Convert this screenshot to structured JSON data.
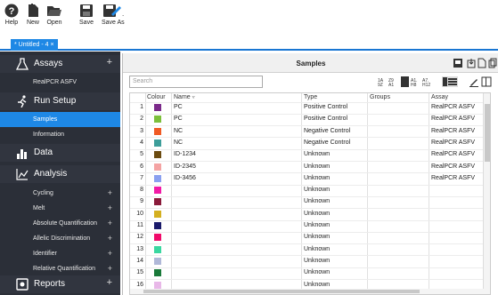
{
  "toolbar": {
    "help": "Help",
    "new": "New",
    "open": "Open",
    "save": "Save",
    "save_as": "Save As"
  },
  "tab": {
    "label": "* Untitled - 4  ×"
  },
  "sidebar": {
    "assays": "Assays",
    "realpcr": "RealPCR ASFV",
    "run_setup": "Run Setup",
    "samples": "Samples",
    "information": "Information",
    "data": "Data",
    "analysis": "Analysis",
    "cycling": "Cycling",
    "melt": "Melt",
    "absolute": "Absolute Quantification",
    "allelic": "Allelic Discrimination",
    "identifier": "Identifier",
    "relative": "Relative Quantification",
    "reports": "Reports",
    "plus": "+"
  },
  "panel": {
    "title": "Samples",
    "search_placeholder": "Search"
  },
  "table": {
    "headers": {
      "colour": "Colour",
      "name": "Name",
      "type": "Type",
      "groups": "Groups",
      "assay": "Assay"
    },
    "rows": [
      {
        "n": "1",
        "color": "#7b2a8a",
        "name": "PC",
        "type": "Positive Control",
        "groups": "",
        "assay": "RealPCR ASFV"
      },
      {
        "n": "2",
        "color": "#7cbf3b",
        "name": "PC",
        "type": "Positive Control",
        "groups": "",
        "assay": "RealPCR ASFV"
      },
      {
        "n": "3",
        "color": "#f05a24",
        "name": "NC",
        "type": "Negative Control",
        "groups": "",
        "assay": "RealPCR ASFV"
      },
      {
        "n": "4",
        "color": "#3d9e9a",
        "name": "NC",
        "type": "Negative Control",
        "groups": "",
        "assay": "RealPCR ASFV"
      },
      {
        "n": "5",
        "color": "#6b4b10",
        "name": "ID-1234",
        "type": "Unknown",
        "groups": "",
        "assay": "RealPCR ASFV"
      },
      {
        "n": "6",
        "color": "#f4a3a3",
        "name": "ID-2345",
        "type": "Unknown",
        "groups": "",
        "assay": "RealPCR ASFV"
      },
      {
        "n": "7",
        "color": "#8aa0f0",
        "name": "ID-3456",
        "type": "Unknown",
        "groups": "",
        "assay": "RealPCR ASFV"
      },
      {
        "n": "8",
        "color": "#f21aa6",
        "name": "",
        "type": "Unknown",
        "groups": "",
        "assay": ""
      },
      {
        "n": "9",
        "color": "#8a1a3a",
        "name": "",
        "type": "Unknown",
        "groups": "",
        "assay": ""
      },
      {
        "n": "10",
        "color": "#d4b020",
        "name": "",
        "type": "Unknown",
        "groups": "",
        "assay": ""
      },
      {
        "n": "11",
        "color": "#1a1a6a",
        "name": "",
        "type": "Unknown",
        "groups": "",
        "assay": ""
      },
      {
        "n": "12",
        "color": "#f00a6a",
        "name": "",
        "type": "Unknown",
        "groups": "",
        "assay": ""
      },
      {
        "n": "13",
        "color": "#3ad7a0",
        "name": "",
        "type": "Unknown",
        "groups": "",
        "assay": ""
      },
      {
        "n": "14",
        "color": "#b0b8d8",
        "name": "",
        "type": "Unknown",
        "groups": "",
        "assay": ""
      },
      {
        "n": "15",
        "color": "#1a7a3a",
        "name": "",
        "type": "Unknown",
        "groups": "",
        "assay": ""
      },
      {
        "n": "16",
        "color": "#e8b8e8",
        "name": "",
        "type": "Unknown",
        "groups": "",
        "assay": ""
      }
    ]
  }
}
